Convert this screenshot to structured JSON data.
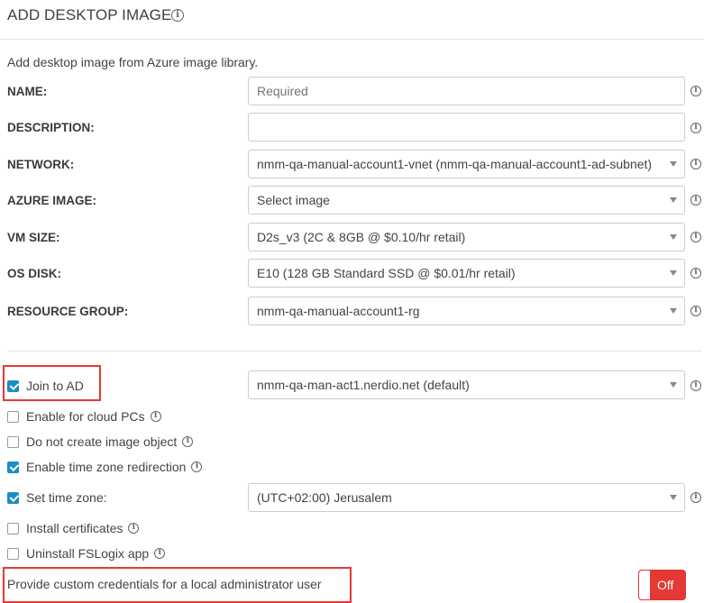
{
  "header": {
    "title": "ADD DESKTOP IMAGE",
    "info_icon": "info-icon"
  },
  "subtitle": "Add desktop image from Azure image library.",
  "fields": {
    "name": {
      "label": "NAME:",
      "value": "",
      "placeholder": "Required"
    },
    "description": {
      "label": "DESCRIPTION:",
      "value": ""
    },
    "network": {
      "label": "NETWORK:",
      "value": "nmm-qa-manual-account1-vnet (nmm-qa-manual-account1-ad-subnet)"
    },
    "azure_image": {
      "label": "AZURE IMAGE:",
      "value": "Select image"
    },
    "vm_size": {
      "label": "VM SIZE:",
      "value": "D2s_v3 (2C & 8GB @ $0.10/hr retail)"
    },
    "os_disk": {
      "label": "OS DISK:",
      "value": "E10 (128 GB Standard SSD @ $0.01/hr retail)"
    },
    "resource_group": {
      "label": "RESOURCE GROUP:",
      "value": "nmm-qa-manual-account1-rg"
    }
  },
  "options": {
    "join_ad": {
      "label": "Join to AD",
      "checked": true,
      "domain": "nmm-qa-man-act1.nerdio.net (default)"
    },
    "cloud_pcs": {
      "label": "Enable for cloud PCs",
      "checked": false
    },
    "no_image_object": {
      "label": "Do not create image object",
      "checked": false
    },
    "tz_redirection": {
      "label": "Enable time zone redirection",
      "checked": true
    },
    "set_time_zone": {
      "label": "Set time zone:",
      "checked": true,
      "value": "(UTC+02:00) Jerusalem"
    },
    "install_certs": {
      "label": "Install certificates",
      "checked": false
    },
    "uninstall_fslogix": {
      "label": "Uninstall FSLogix app",
      "checked": false
    }
  },
  "credentials": {
    "label": "Provide custom credentials for a local administrator user",
    "toggle": "Off"
  },
  "colors": {
    "accent": "#1a8ec4",
    "highlight": "#e53935",
    "toggle_off": "#e53935"
  }
}
